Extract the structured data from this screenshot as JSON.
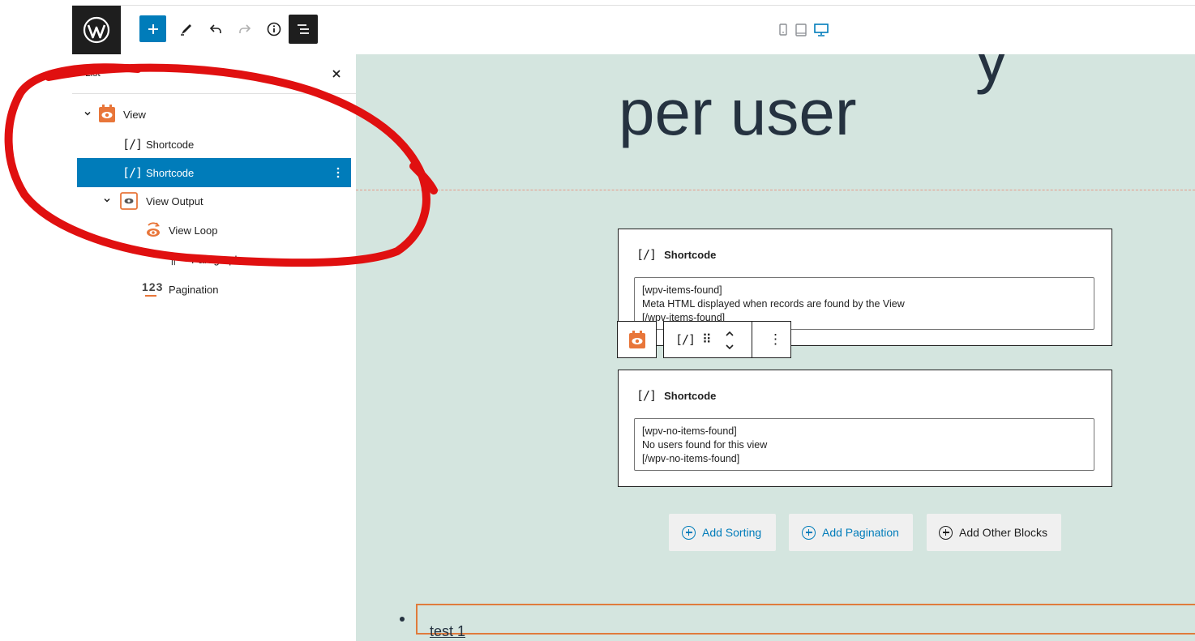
{
  "toolbar": {
    "add_label": "Add block",
    "tools": [
      "pencil-icon",
      "undo-icon",
      "redo-icon",
      "info-icon",
      "list-view-icon"
    ],
    "devices": [
      "mobile-icon",
      "tablet-icon",
      "desktop-icon"
    ],
    "accent": "#007cba"
  },
  "sidebar": {
    "title": "List",
    "close_label": "×",
    "items": [
      {
        "label": "View",
        "icon": "view-block-icon",
        "level": 0,
        "expanded": true
      },
      {
        "label": "Shortcode",
        "icon": "shortcode-icon",
        "level": 1
      },
      {
        "label": "Shortcode",
        "icon": "shortcode-icon",
        "level": 1,
        "selected": true
      },
      {
        "label": "View Output",
        "icon": "view-output-icon",
        "level": 1,
        "expanded": true
      },
      {
        "label": "View Loop",
        "icon": "view-loop-icon",
        "level": 2
      },
      {
        "label": "Paragraph",
        "icon": "paragraph-icon",
        "level": 3
      },
      {
        "label": "Pagination",
        "icon": "pagination-icon",
        "level": 2
      }
    ],
    "shortcode_glyph": "[/]",
    "pagination_glyph": "123",
    "paragraph_glyph": "¶"
  },
  "canvas": {
    "heading": "per user",
    "heading_partial_above": "y",
    "cards": [
      {
        "title": "Shortcode",
        "glyph": "[/]",
        "content": "[wpv-items-found]\nMeta HTML displayed when records are found by the View\n[/wpv-items-found]"
      },
      {
        "title": "Shortcode",
        "glyph": "[/]",
        "content": "[wpv-no-items-found]\nNo users found for this view\n[/wpv-no-items-found]"
      }
    ],
    "block_toolbar": {
      "glyph": "[/]",
      "drag": "⠿",
      "more": "⋮"
    },
    "buttons": [
      {
        "label": "Add Sorting",
        "color": "#007cba"
      },
      {
        "label": "Add Pagination",
        "color": "#007cba"
      },
      {
        "label": "Add Other Blocks",
        "color": "#1e1e1e"
      }
    ],
    "list_item": "test 1",
    "background": "#d4e5df"
  },
  "annotation_color": "#e01010"
}
